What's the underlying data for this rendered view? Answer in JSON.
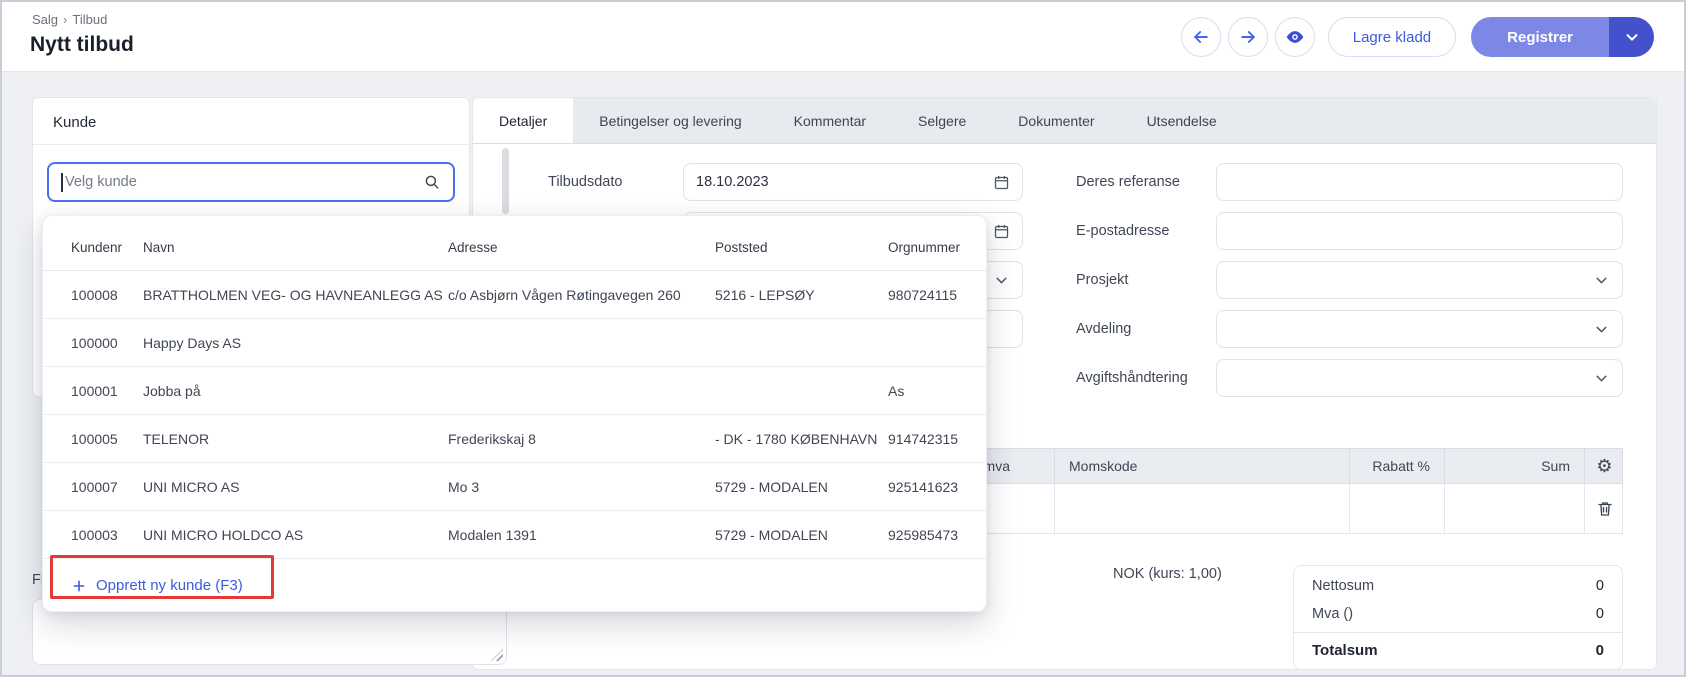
{
  "breadcrumb": {
    "items": [
      "Salg",
      "Tilbud"
    ],
    "separator": "›"
  },
  "page_title": "Nytt tilbud",
  "toolbar": {
    "save_draft_label": "Lagre kladd",
    "register_label": "Registrer",
    "icons": [
      "arrow-left",
      "arrow-right",
      "eye",
      "chevron-down"
    ]
  },
  "customer_panel": {
    "title": "Kunde",
    "search_placeholder": "Velg kunde"
  },
  "customer_dropdown": {
    "columns": {
      "kundenr": "Kundenr",
      "navn": "Navn",
      "adresse": "Adresse",
      "poststed": "Poststed",
      "orgnummer": "Orgnummer"
    },
    "rows": [
      {
        "kundenr": "100008",
        "navn": "BRATTHOLMEN VEG- OG HAVNEANLEGG AS",
        "adresse": "c/o Asbjørn Vågen Røtingavegen 260",
        "poststed": "5216 - LEPSØY",
        "orgnummer": "980724115"
      },
      {
        "kundenr": "100000",
        "navn": "Happy Days AS",
        "adresse": "",
        "poststed": "",
        "orgnummer": ""
      },
      {
        "kundenr": "100001",
        "navn": "Jobba på",
        "adresse": "",
        "poststed": "",
        "orgnummer": "As"
      },
      {
        "kundenr": "100005",
        "navn": "TELENOR",
        "adresse": "Frederikskaj 8",
        "poststed": "- DK - 1780 KØBENHAVN",
        "orgnummer": "914742315"
      },
      {
        "kundenr": "100007",
        "navn": "UNI MICRO AS",
        "adresse": "Mo 3",
        "poststed": "5729 - MODALEN",
        "orgnummer": "925141623"
      },
      {
        "kundenr": "100003",
        "navn": "UNI MICRO HOLDCO AS",
        "adresse": "Modalen 1391",
        "poststed": "5729 - MODALEN",
        "orgnummer": "925985473"
      }
    ],
    "create_new_label": "Opprett ny kunde (F3)"
  },
  "tabs": [
    {
      "label": "Detaljer",
      "active": true
    },
    {
      "label": "Betingelser og levering",
      "active": false
    },
    {
      "label": "Kommentar",
      "active": false
    },
    {
      "label": "Selgere",
      "active": false
    },
    {
      "label": "Dokumenter",
      "active": false
    },
    {
      "label": "Utsendelse",
      "active": false
    }
  ],
  "details_form": {
    "rows_left": [
      {
        "label": "Tilbudsdato",
        "value": "18.10.2023",
        "icon": "calendar"
      },
      {
        "label": "",
        "value": "",
        "icon": "calendar"
      },
      {
        "label": "",
        "value": "",
        "icon": "chevron-down"
      },
      {
        "label": "",
        "value": "",
        "icon": "none"
      }
    ],
    "rows_right": [
      {
        "label": "Deres referanse",
        "value": "",
        "type": "input"
      },
      {
        "label": "E-postadresse",
        "value": "",
        "type": "input"
      },
      {
        "label": "Prosjekt",
        "value": "",
        "type": "select"
      },
      {
        "label": "Avdeling",
        "value": "",
        "type": "select"
      },
      {
        "label": "Avgiftshåndtering",
        "value": "",
        "type": "select"
      }
    ]
  },
  "lines_table": {
    "headers": {
      "mva": ". mva",
      "momskode": "Momskode",
      "rabatt": "Rabatt %",
      "sum": "Sum"
    },
    "icons": [
      "gear",
      "trash"
    ]
  },
  "currency_note": "NOK (kurs: 1,00)",
  "totals": {
    "rows": [
      {
        "label": "Nettosum",
        "value": "0"
      },
      {
        "label": "Mva ()",
        "value": "0"
      }
    ],
    "total": {
      "label": "Totalsum",
      "value": "0"
    }
  },
  "freetext_label": "Fri",
  "colors": {
    "accent_blue": "#3b5bdb",
    "register_button": "#7d88e6",
    "register_dropdown": "#4351cc",
    "annotation_red": "#e23a36",
    "page_background": "#eef0f4",
    "tabbar_background": "#e7eaef"
  }
}
